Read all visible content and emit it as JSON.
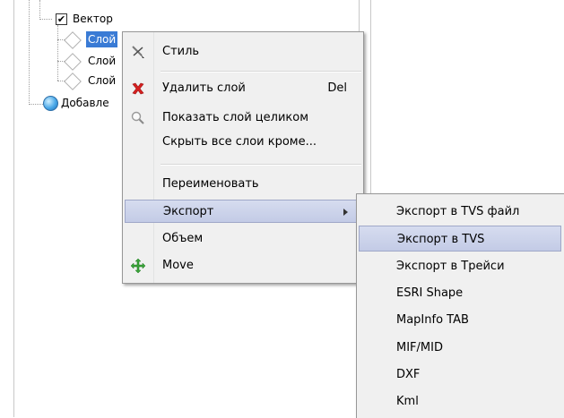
{
  "tree": {
    "items": [
      {
        "label": "Вектор",
        "checked": true
      },
      {
        "label": "Слой",
        "selected": true
      },
      {
        "label": "Слой"
      },
      {
        "label": "Слой"
      },
      {
        "label": "Добавле"
      }
    ],
    "checkmark": "✔"
  },
  "context_menu": {
    "items": [
      {
        "label": "Стиль",
        "icon": "brush-icon"
      },
      {
        "label": "Удалить слой",
        "shortcut": "Del",
        "icon": "delete-icon"
      },
      {
        "label": "Показать слой целиком",
        "icon": "zoom-icon"
      },
      {
        "label": "Скрыть все слои кроме..."
      },
      {
        "label": "Переименовать"
      },
      {
        "label": "Экспорт",
        "has_submenu": true,
        "highlighted": true
      },
      {
        "label": "Объем"
      },
      {
        "label": "Move",
        "icon": "move-icon"
      }
    ]
  },
  "export_submenu": {
    "items": [
      {
        "label": "Экспорт в TVS файл"
      },
      {
        "label": "Экспорт в TVS",
        "highlighted": true
      },
      {
        "label": "Экспорт в Трейси"
      },
      {
        "label": "ESRI Shape"
      },
      {
        "label": "MapInfo TAB"
      },
      {
        "label": "MIF/MID"
      },
      {
        "label": "DXF"
      },
      {
        "label": "Kml"
      }
    ]
  },
  "colors": {
    "selection": "#3a7bd5",
    "menu_bg": "#f0f0f0",
    "highlight": "#c8d0ea",
    "delete_icon": "#d62020",
    "move_icon": "#3aa33a"
  }
}
